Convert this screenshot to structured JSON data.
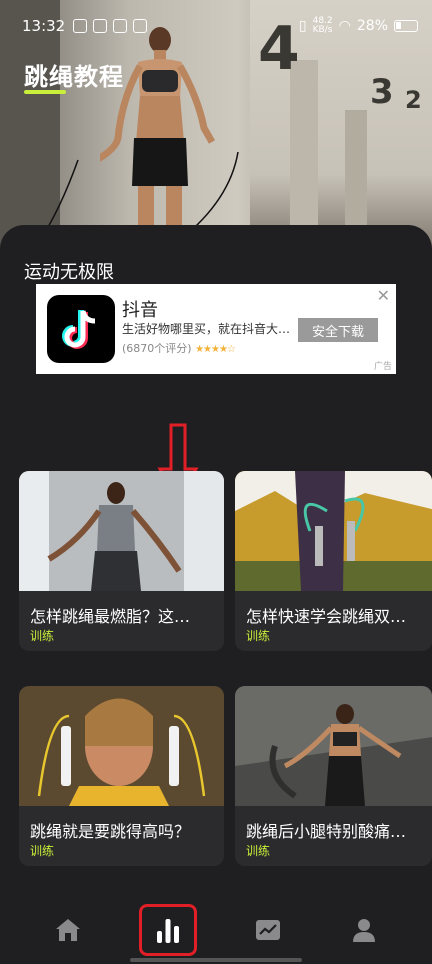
{
  "status_bar": {
    "time": "13:32",
    "net_speed_value": "48.2",
    "net_speed_unit": "KB/s",
    "battery": "28%"
  },
  "hero": {
    "title": "跳绳教程",
    "wall_numbers": [
      "4",
      "3",
      "2"
    ]
  },
  "section": {
    "title": "运动无极限"
  },
  "ad": {
    "app_name": "抖音",
    "description": "生活好物哪里买，就在抖音大…",
    "rating_text": "(6870个评分)",
    "stars": "★★★★☆",
    "download_label": "安全下载",
    "close_glyph": "✕",
    "ad_tag": "广告"
  },
  "cards": [
    {
      "title": "怎样跳绳最燃脂？这…",
      "tag": "训练"
    },
    {
      "title": "怎样快速学会跳绳双…",
      "tag": "训练"
    },
    {
      "title": "跳绳就是要跳得高吗？",
      "tag": "训练"
    },
    {
      "title": "跳绳后小腿特别酸痛…",
      "tag": "训练"
    }
  ],
  "nav": {
    "items": [
      {
        "icon": "home-icon"
      },
      {
        "icon": "stats-bars-icon"
      },
      {
        "icon": "trend-chart-icon"
      },
      {
        "icon": "user-icon"
      }
    ],
    "active_index": 1
  },
  "colors": {
    "accent": "#c9ef3a",
    "background": "#1f1f21",
    "card": "#2b2b2d",
    "annotation_red": "#e01f26"
  }
}
